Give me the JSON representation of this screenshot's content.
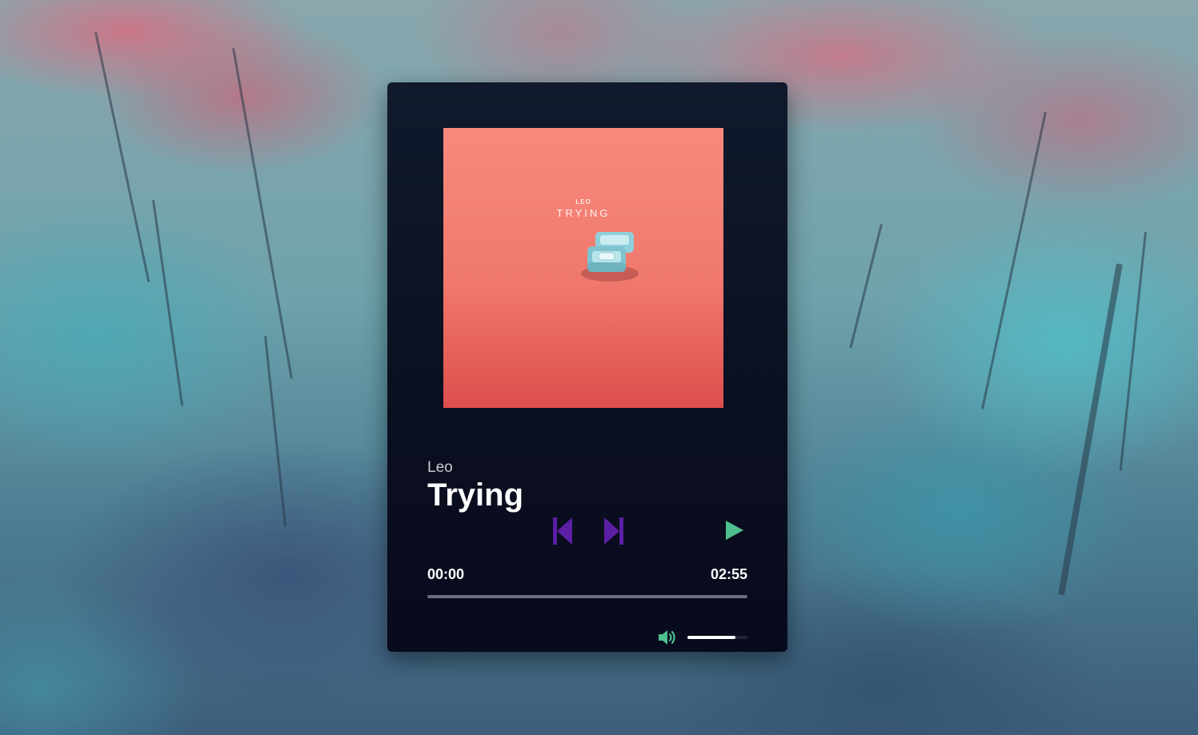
{
  "player": {
    "cover": {
      "artist_text": "LEO",
      "title_text": "TRYING",
      "colors": {
        "top": "#f78a7c",
        "bottom": "#dd4f4e",
        "ring_box": "#7fc3cf"
      }
    },
    "artist": "Leo",
    "title": "Trying",
    "controls": {
      "prev_icon": "skip-previous-icon",
      "next_icon": "skip-next-icon",
      "play_icon": "play-icon",
      "skip_color": "#5b1fa5",
      "play_color": "#4fbf8f"
    },
    "time": {
      "current": "00:00",
      "total": "02:55"
    },
    "progress": {
      "fraction": 0.0
    },
    "volume": {
      "icon": "volume-icon",
      "fraction": 0.8
    }
  }
}
